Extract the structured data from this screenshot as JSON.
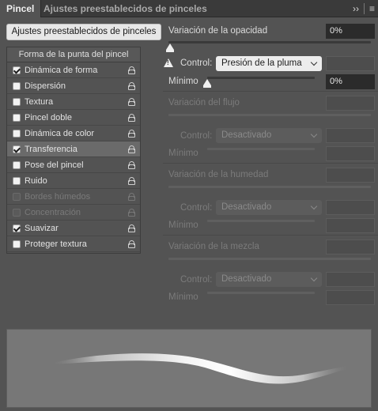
{
  "tabs": {
    "active": "Pincel",
    "inactive": "Ajustes preestablecidos de pinceles",
    "more_icon": "double-chevron-right-icon",
    "menu_icon": "hamburger-menu-icon"
  },
  "presets_button": "Ajustes preestablecidos de pinceles",
  "list": {
    "header": "Forma de la punta del pincel",
    "items": [
      {
        "label": "Dinámica de forma",
        "checked": true,
        "disabled": false,
        "selected": false
      },
      {
        "label": "Dispersión",
        "checked": false,
        "disabled": false,
        "selected": false
      },
      {
        "label": "Textura",
        "checked": false,
        "disabled": false,
        "selected": false
      },
      {
        "label": "Pincel doble",
        "checked": false,
        "disabled": false,
        "selected": false
      },
      {
        "label": "Dinámica de color",
        "checked": false,
        "disabled": false,
        "selected": false
      },
      {
        "label": "Transferencia",
        "checked": true,
        "disabled": false,
        "selected": true
      },
      {
        "label": "Pose del pincel",
        "checked": false,
        "disabled": false,
        "selected": false
      },
      {
        "label": "Ruido",
        "checked": false,
        "disabled": false,
        "selected": false
      },
      {
        "label": "Bordes húmedos",
        "checked": false,
        "disabled": true,
        "selected": false
      },
      {
        "label": "Concentración",
        "checked": false,
        "disabled": true,
        "selected": false
      },
      {
        "label": "Suavizar",
        "checked": true,
        "disabled": false,
        "selected": false
      },
      {
        "label": "Proteger textura",
        "checked": false,
        "disabled": false,
        "selected": false
      }
    ]
  },
  "opacity": {
    "label": "Variación de la opacidad",
    "value": "0%",
    "control_label": "Control:",
    "control_value": "Presión de la pluma",
    "minimum_label": "Mínimo",
    "minimum_value": "0%"
  },
  "flow": {
    "label": "Variación del flujo",
    "control_label": "Control:",
    "control_value": "Desactivado",
    "minimum_label": "Mínimo"
  },
  "wetness": {
    "label": "Variación de la humedad",
    "control_label": "Control:",
    "control_value": "Desactivado",
    "minimum_label": "Mínimo"
  },
  "mix": {
    "label": "Variación de la mezcla",
    "control_label": "Control:",
    "control_value": "Desactivado",
    "minimum_label": "Mínimo"
  }
}
